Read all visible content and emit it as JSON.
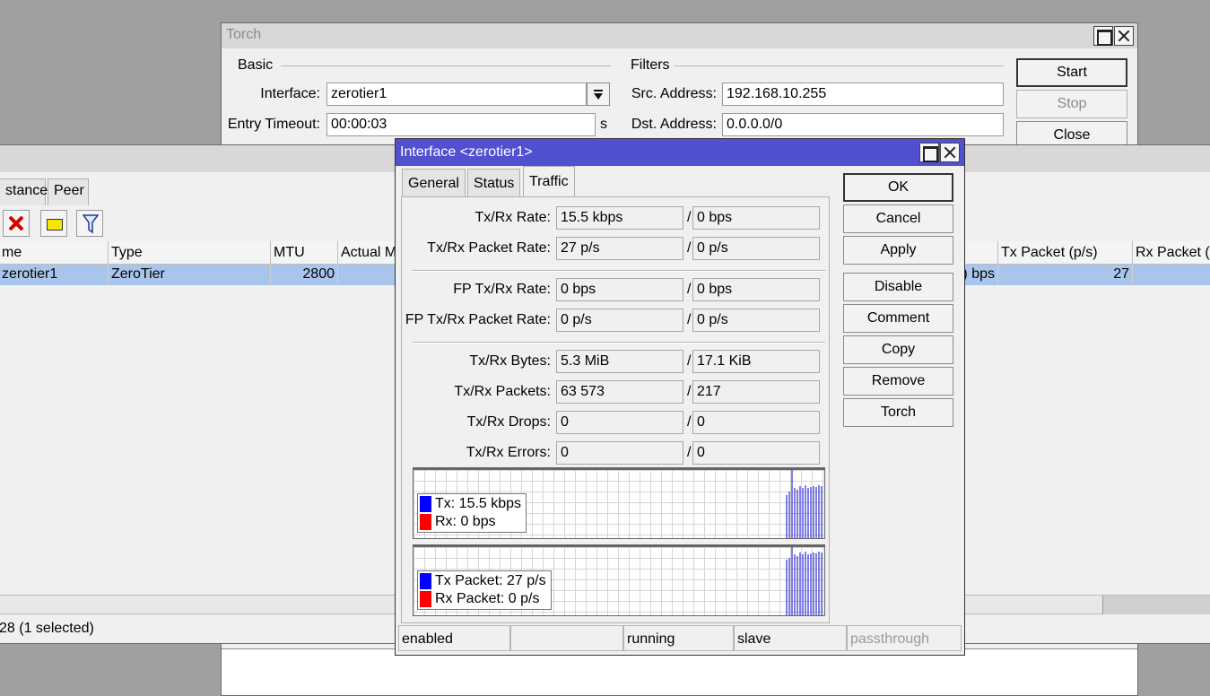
{
  "torch": {
    "title": "Torch",
    "basic_label": "Basic",
    "filters_label": "Filters",
    "interface_label": "Interface:",
    "interface_value": "zerotier1",
    "entry_timeout_label": "Entry Timeout:",
    "entry_timeout_value": "00:00:03",
    "entry_timeout_unit": "s",
    "src_address_label": "Src. Address:",
    "src_address_value": "192.168.10.255",
    "dst_address_label": "Dst. Address:",
    "dst_address_value": "0.0.0.0/0",
    "start_label": "Start",
    "stop_label": "Stop",
    "close_label": "Close"
  },
  "interface_list": {
    "tabs": [
      "stance",
      "Peer"
    ],
    "columns": [
      "me",
      "Type",
      "MTU",
      "Actual M",
      "Tx Packet (p/s)",
      "Rx Packet (p"
    ],
    "row": {
      "name": "zerotier1",
      "type": "ZeroTier",
      "mtu": "2800",
      "partial": ") bps",
      "tx_packet": "27"
    },
    "status": "28 (1 selected)"
  },
  "dialog": {
    "title": "Interface <zerotier1>",
    "tabs": [
      "General",
      "Status",
      "Traffic"
    ],
    "active_tab": "Traffic",
    "fields": [
      {
        "label": "Tx/Rx Rate:",
        "tx": "15.5 kbps",
        "rx": "0 bps"
      },
      {
        "label": "Tx/Rx Packet Rate:",
        "tx": "27 p/s",
        "rx": "0 p/s"
      },
      {
        "label": "FP Tx/Rx Rate:",
        "tx": "0 bps",
        "rx": "0 bps"
      },
      {
        "label": "FP Tx/Rx Packet Rate:",
        "tx": "0 p/s",
        "rx": "0 p/s"
      },
      {
        "label": "Tx/Rx Bytes:",
        "tx": "5.3 MiB",
        "rx": "17.1 KiB"
      },
      {
        "label": "Tx/Rx Packets:",
        "tx": "63 573",
        "rx": "217"
      },
      {
        "label": "Tx/Rx Drops:",
        "tx": "0",
        "rx": "0"
      },
      {
        "label": "Tx/Rx Errors:",
        "tx": "0",
        "rx": "0"
      }
    ],
    "slash": "/",
    "graph1": {
      "tx": "Tx:  15.5 kbps",
      "rx": "Rx:  0 bps"
    },
    "graph2": {
      "tx": "Tx Packet:  27 p/s",
      "rx": "Rx Packet:  0 p/s"
    },
    "buttons": {
      "ok": "OK",
      "cancel": "Cancel",
      "apply": "Apply",
      "disable": "Disable",
      "comment": "Comment",
      "copy": "Copy",
      "remove": "Remove",
      "torch": "Torch"
    },
    "status": {
      "enabled": "enabled",
      "empty": "",
      "running": "running",
      "slave": "slave",
      "passthrough": "passthrough"
    }
  },
  "colors": {
    "dialog_title": "#5050d0",
    "selected_row": "#a8c6ec",
    "tx_series": "#0000ff",
    "rx_series": "#ff0000"
  }
}
